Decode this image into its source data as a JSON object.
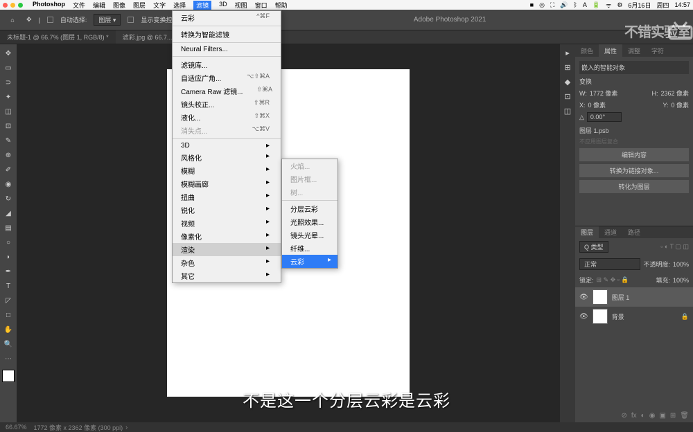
{
  "mac": {
    "app": "Photoshop",
    "menus": [
      "文件",
      "编辑",
      "图像",
      "图层",
      "文字",
      "选择",
      "滤镜",
      "3D",
      "视图",
      "窗口",
      "帮助"
    ],
    "time": "14:57",
    "date": "6月16日",
    "day": "周四"
  },
  "options": {
    "auto_select": "自动选择:",
    "layer": "图层",
    "show_transform": "显示变换控件",
    "title_center": "Adobe Photoshop 2021"
  },
  "tabs": [
    {
      "label": "未标题-1 @ 66.7% (图层 1, RGB/8) *"
    },
    {
      "label": "滤彩.jpg @ 66.7..."
    }
  ],
  "filter_menu": {
    "last": {
      "label": "云彩",
      "shortcut": "^⌘F"
    },
    "convert": "转换为智能滤镜",
    "neural": "Neural Filters...",
    "items": [
      {
        "label": "滤镜库..."
      },
      {
        "label": "自适应广角...",
        "shortcut": "⌥⇧⌘A"
      },
      {
        "label": "Camera Raw 滤镜...",
        "shortcut": "⇧⌘A"
      },
      {
        "label": "镜头校正...",
        "shortcut": "⇧⌘R"
      },
      {
        "label": "液化...",
        "shortcut": "⇧⌘X"
      },
      {
        "label": "消失点...",
        "shortcut": "⌥⌘V",
        "disabled": true
      }
    ],
    "subs": [
      "3D",
      "风格化",
      "模糊",
      "模糊画廊",
      "扭曲",
      "锐化",
      "视频",
      "像素化",
      "渲染",
      "杂色",
      "其它"
    ]
  },
  "render_submenu": {
    "disabled": [
      "火焰...",
      "图片框...",
      "树..."
    ],
    "items": [
      "分层云彩",
      "光照效果...",
      "镜头光晕...",
      "纤维..."
    ],
    "selected": "云彩"
  },
  "props": {
    "tabs": [
      "颜色",
      "属性",
      "调整",
      "字符"
    ],
    "smart_obj": "嵌入的智能对象",
    "transform": "变换",
    "W_label": "W:",
    "W": "1772 像素",
    "H_label": "H:",
    "H": "2362 像素",
    "X_label": "X:",
    "X": "0 像素",
    "Y_label": "Y:",
    "Y": "0 像素",
    "angle": "0.00°",
    "layer_psb": "图层 1.psb",
    "edit_content": "编辑内容",
    "convert_linked": "转换为链接对象...",
    "convert_layer": "转化为图层"
  },
  "layers": {
    "tabs": [
      "图层",
      "通道",
      "路径"
    ],
    "kind": "Q 类型",
    "normal": "正常",
    "opacity_label": "不透明度:",
    "opacity": "100%",
    "lock": "锁定:",
    "fill_label": "填充:",
    "fill": "100%",
    "items": [
      {
        "name": "图层 1"
      },
      {
        "name": "背景"
      }
    ]
  },
  "status": {
    "zoom": "66.67%",
    "dims": "1772 像素 x 2362 像素 (300 ppi)"
  },
  "subtitle": "不是这一个分层云彩是云彩",
  "watermark": "不错实验室"
}
